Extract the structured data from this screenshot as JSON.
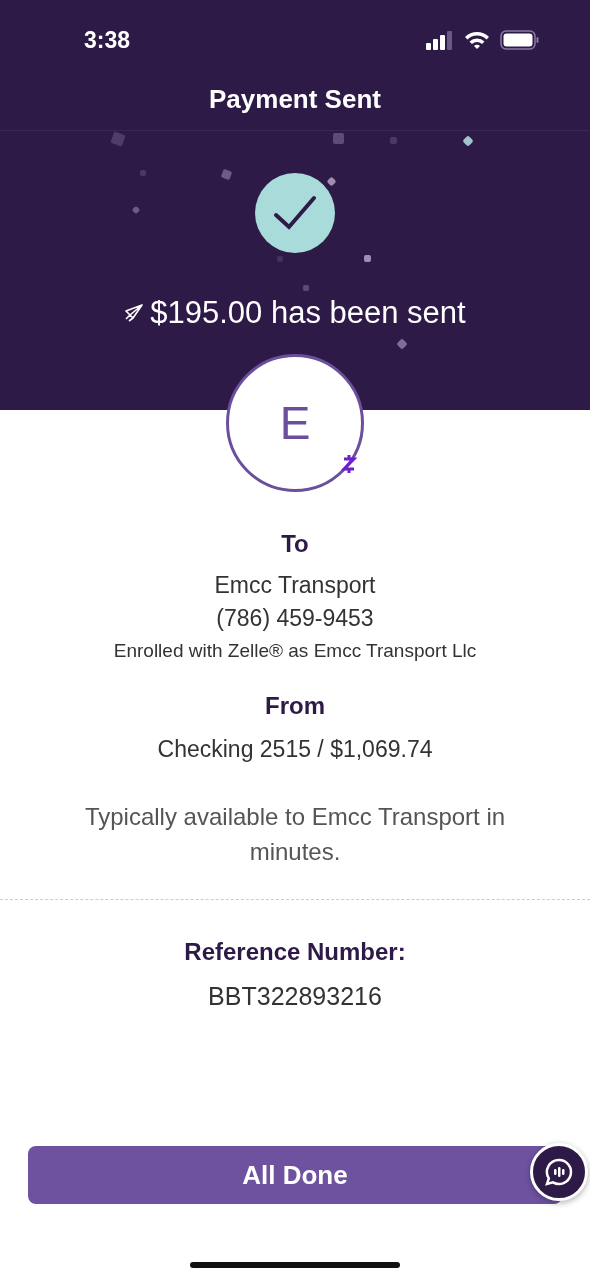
{
  "status_bar": {
    "time": "3:38"
  },
  "header": {
    "title": "Payment Sent"
  },
  "confirmation": {
    "amount_message": "$195.00 has been sent"
  },
  "recipient": {
    "initial": "E",
    "to_label": "To",
    "name": "Emcc Transport",
    "phone": "(786) 459-9453",
    "enrolled": "Enrolled with Zelle® as Emcc Transport Llc"
  },
  "sender": {
    "from_label": "From",
    "account": "Checking 2515 / $1,069.74"
  },
  "availability": "Typically available to Emcc Transport in minutes.",
  "reference": {
    "label": "Reference Number:",
    "number": "BBT322893216"
  },
  "primary_button": {
    "label": "All Done"
  }
}
